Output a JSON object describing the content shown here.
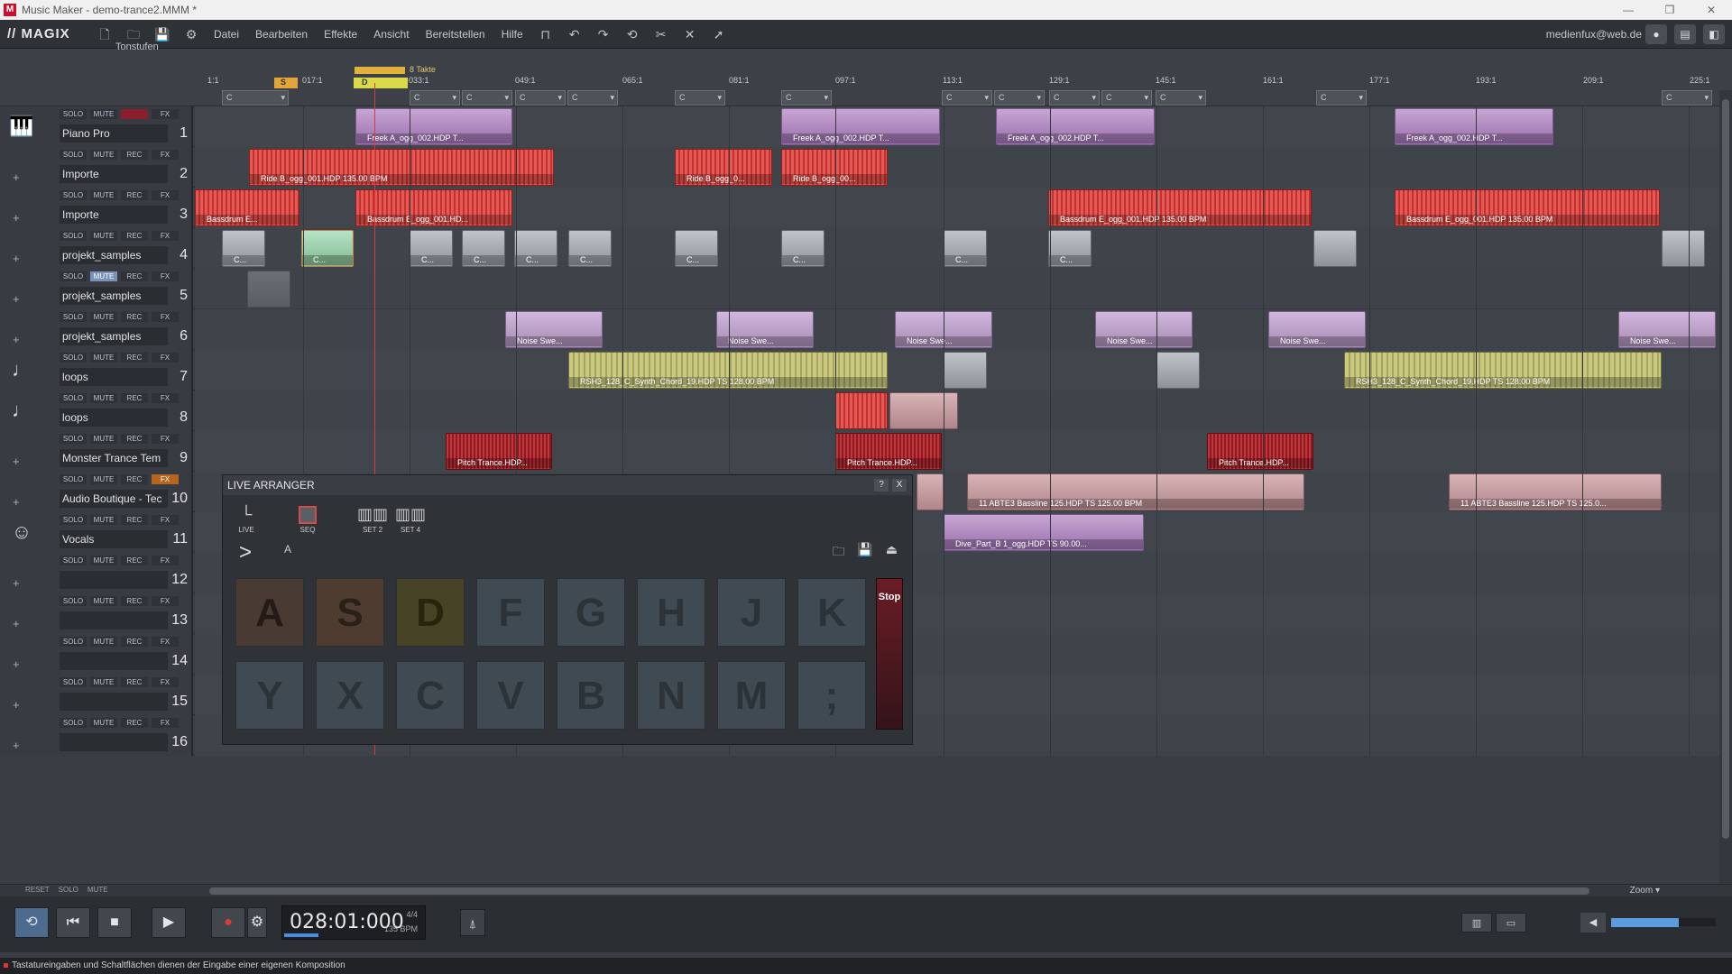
{
  "window": {
    "title": "Music Maker - demo-trance2.MMM *"
  },
  "menubar": {
    "logo": "// MAGIX",
    "items": [
      "Datei",
      "Bearbeiten",
      "Effekte",
      "Ansicht",
      "Bereitstellen",
      "Hilfe"
    ],
    "account": "medienfux@web.de"
  },
  "ruler": {
    "tonstufen_label": "Tonstufen",
    "loop_label": "8 Takte",
    "marker_s": "S",
    "marker_d": "D",
    "ticks": [
      "1:1",
      "017:1",
      "033:1",
      "049:1",
      "065:1",
      "081:1",
      "097:1",
      "113:1",
      "129:1",
      "145:1",
      "161:1",
      "177:1",
      "193:1",
      "209:1",
      "225:1"
    ],
    "chord": "C"
  },
  "track_buttons": {
    "solo": "SOLO",
    "mute": "MUTE",
    "rec": "REC",
    "fx": "FX"
  },
  "tracks": [
    {
      "name": "Piano Pro",
      "num": "1"
    },
    {
      "name": "Importe",
      "num": "2"
    },
    {
      "name": "Importe",
      "num": "3"
    },
    {
      "name": "projekt_samples",
      "num": "4"
    },
    {
      "name": "projekt_samples",
      "num": "5"
    },
    {
      "name": "projekt_samples",
      "num": "6"
    },
    {
      "name": "loops",
      "num": "7"
    },
    {
      "name": "loops",
      "num": "8"
    },
    {
      "name": "Monster Trance Tem",
      "num": "9"
    },
    {
      "name": "Audio Boutique - Tec",
      "num": "10"
    },
    {
      "name": "Vocals",
      "num": "11"
    },
    {
      "name": "",
      "num": "12"
    },
    {
      "name": "",
      "num": "13"
    },
    {
      "name": "",
      "num": "14"
    },
    {
      "name": "",
      "num": "15"
    },
    {
      "name": "",
      "num": "16"
    }
  ],
  "clips": {
    "freek": "Freek A_ogg_002.HDP T...",
    "freek_end": "Freek A_ogg_002.HDP T...",
    "ride1": "Ride B_ogg_001.HDP 135.00 BPM",
    "ride2": "Ride B_ogg_0...",
    "ride3": "Ride B_ogg_00...",
    "bass_e1": "Bassdrum E...",
    "bass_e2": "Bassdrum E_ogg_001.HD...",
    "bass_e3": "Bassdrum E_ogg_001.HDP  135.00 BPM",
    "bass_e4": "Bassdrum E_ogg_001.HDP  135.00 BPM",
    "c_short": "C...",
    "noise": "Noise Swe...",
    "synth_chord": "RSH3_128_C_Synth_Chord_19.HDP  TS  128.00 BPM",
    "synth_chord2": "RSH3_128_C_Synth_Chord_19.HDP  TS  128.00 BPM",
    "pitch": "Pitch Trance.HDP...",
    "bassline1": "11 ABTE3 Bassline 125.HDP  TS  125.00 BPM",
    "bassline2": "11 ABTE3 Bassline 125.HDP  TS  125.0...",
    "dive": "Dive_Part_B 1_ogg.HDP  TS  90.00..."
  },
  "live_arranger": {
    "title": "LIVE ARRANGER",
    "help": "?",
    "close": "X",
    "modes": [
      "LIVE",
      "SEQ",
      "SET 2",
      "SET 4"
    ],
    "input_value": "A",
    "stop_label": "Stop",
    "keys_row1": [
      "A",
      "S",
      "D",
      "F",
      "G",
      "H",
      "J",
      "K"
    ],
    "keys_row2": [
      "Y",
      "X",
      "C",
      "V",
      "B",
      "N",
      "M",
      ";"
    ]
  },
  "scrollbar": {
    "reset": "RESET",
    "solo": "SOLO",
    "mute": "MUTE",
    "zoom": "Zoom ▾"
  },
  "transport": {
    "timecode": "028:01:000",
    "signature": "4/4",
    "bpm": "135 BPM",
    "volume_fraction": 0.65
  },
  "status": {
    "text": "Tastatureingaben und Schaltflächen dienen der Eingabe einer eigenen Komposition"
  },
  "colors": {
    "playhead": "#d83b3b",
    "accent": "#4c6b8f"
  }
}
